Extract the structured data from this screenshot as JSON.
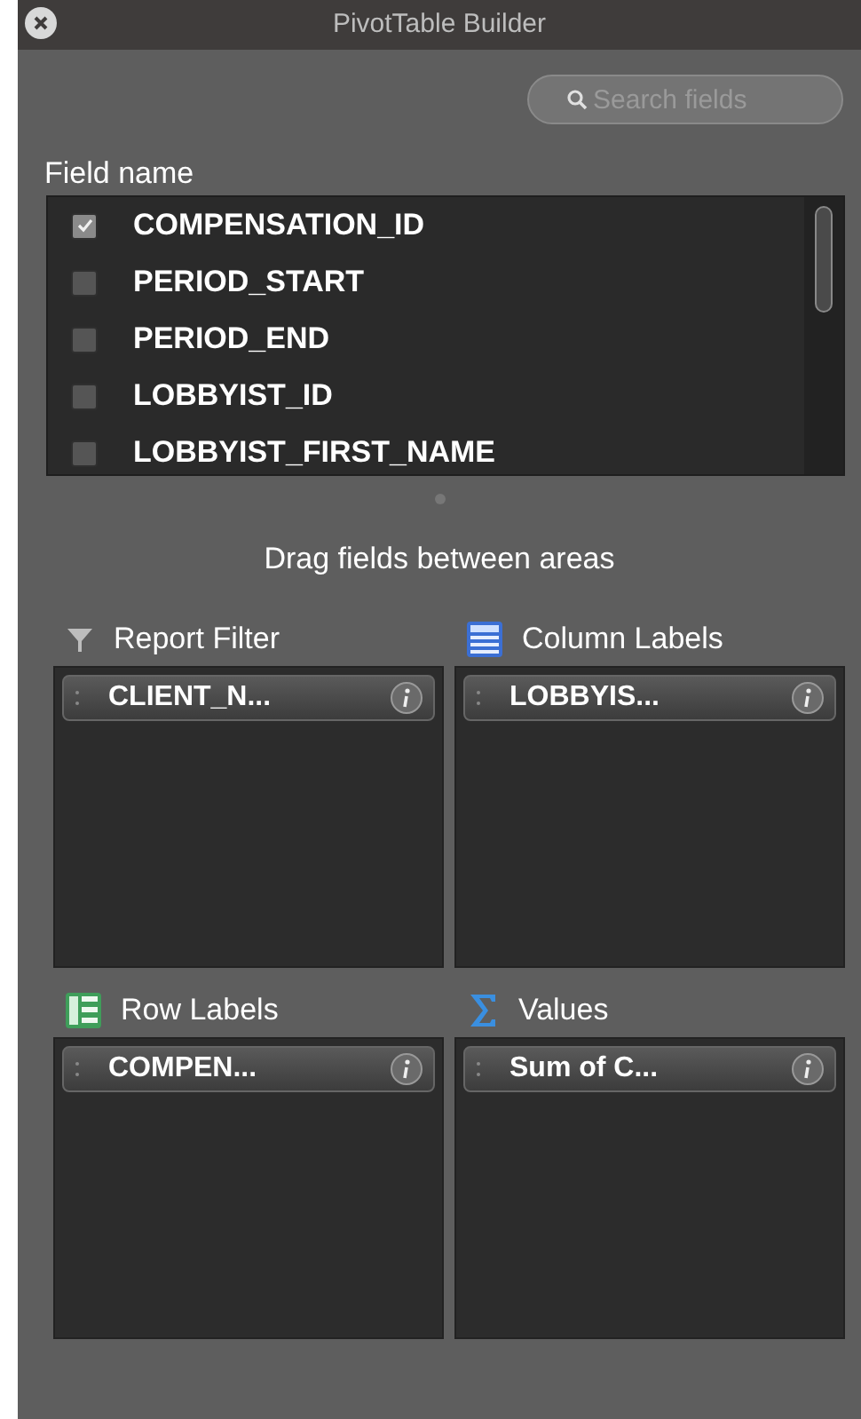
{
  "window": {
    "title": "PivotTable Builder"
  },
  "search": {
    "placeholder": "Search fields"
  },
  "field_list": {
    "heading": "Field name",
    "items": [
      {
        "label": "COMPENSATION_ID",
        "checked": true
      },
      {
        "label": "PERIOD_START",
        "checked": false
      },
      {
        "label": "PERIOD_END",
        "checked": false
      },
      {
        "label": "LOBBYIST_ID",
        "checked": false
      },
      {
        "label": "LOBBYIST_FIRST_NAME",
        "checked": false
      }
    ]
  },
  "hint": "Drag fields between areas",
  "areas": [
    {
      "kind": "filter",
      "title": "Report Filter",
      "fields": [
        "CLIENT_N..."
      ]
    },
    {
      "kind": "columns",
      "title": "Column Labels",
      "fields": [
        "LOBBYIS..."
      ]
    },
    {
      "kind": "rows",
      "title": "Row Labels",
      "fields": [
        "COMPEN..."
      ]
    },
    {
      "kind": "values",
      "title": "Values",
      "fields": [
        "Sum of C..."
      ]
    }
  ]
}
